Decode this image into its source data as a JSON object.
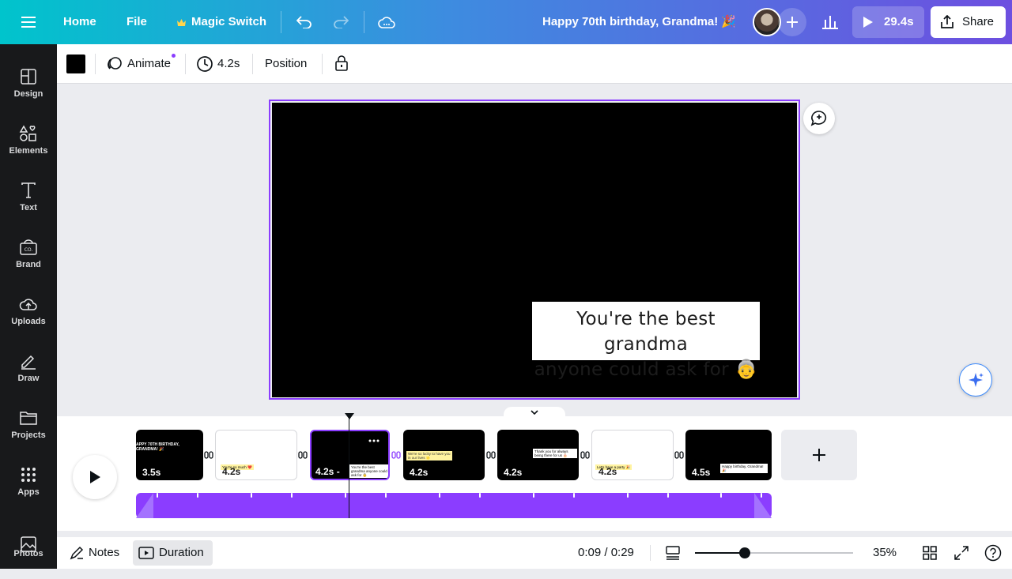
{
  "topbar": {
    "home": "Home",
    "file": "File",
    "magic_switch": "Magic Switch",
    "doc_title": "Happy 70th birthday, Grandma! 🎉",
    "play_duration": "29.4s",
    "share": "Share"
  },
  "rail": {
    "items": [
      {
        "label": "Design",
        "icon": "design-icon"
      },
      {
        "label": "Elements",
        "icon": "elements-icon"
      },
      {
        "label": "Text",
        "icon": "text-icon"
      },
      {
        "label": "Brand",
        "icon": "brand-icon"
      },
      {
        "label": "Uploads",
        "icon": "uploads-icon"
      },
      {
        "label": "Draw",
        "icon": "draw-icon"
      },
      {
        "label": "Projects",
        "icon": "projects-icon"
      },
      {
        "label": "Apps",
        "icon": "apps-icon"
      },
      {
        "label": "Photos",
        "icon": "photos-icon"
      }
    ]
  },
  "toolbar": {
    "color_swatch": "#000000",
    "animate": "Animate",
    "duration": "4.2s",
    "position": "Position"
  },
  "canvas": {
    "caption_line1": "You're the best grandma",
    "caption_line2": "anyone could ask for 👵"
  },
  "timeline": {
    "clips": [
      {
        "duration": "3.5s",
        "text": "APPY 70TH BIRTHDAY, GRANDMA! 🎉",
        "theme": "black"
      },
      {
        "duration": "4.2s",
        "text": "You're so much ❤️",
        "theme": "white"
      },
      {
        "duration": "4.2s -",
        "text": "You're the best grandma anyone could ask for 👵",
        "theme": "black",
        "selected": true
      },
      {
        "duration": "4.2s",
        "text": "We're so lucky to have you in our lives 🌟",
        "theme": "black"
      },
      {
        "duration": "4.2s",
        "text": "Thank you for always being there for us 🎂",
        "theme": "black"
      },
      {
        "duration": "4.2s",
        "text": "Let's have a party 🎉",
        "theme": "white"
      },
      {
        "duration": "4.5s",
        "text": "Happy birthday, Grandma! 🎉",
        "theme": "black"
      }
    ]
  },
  "bottombar": {
    "notes": "Notes",
    "duration": "Duration",
    "time": "0:09 / 0:29",
    "zoom": "35%",
    "zoom_level": 0.35
  },
  "colors": {
    "accent": "#8b3dff",
    "topbar_start": "#00c4cc",
    "topbar_end": "#6d4fe0"
  }
}
